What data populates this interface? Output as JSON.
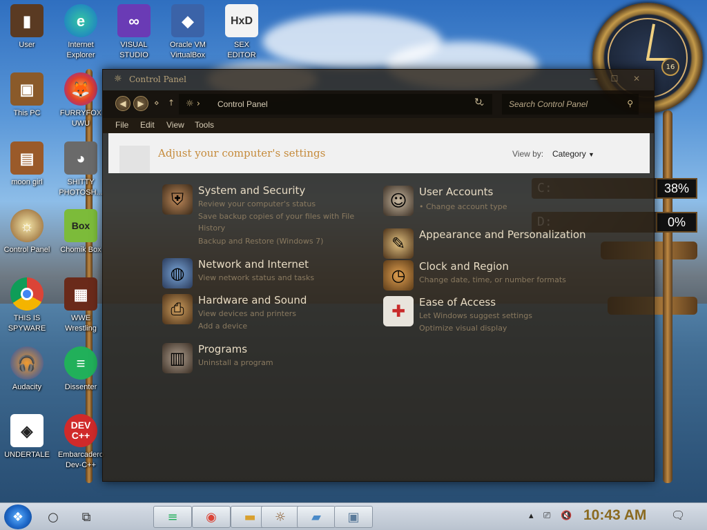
{
  "desktop": {
    "icons": [
      {
        "label": "User",
        "icon": "user-folder-icon"
      },
      {
        "label": "Internet\nExplorer",
        "icon": "edge-icon"
      },
      {
        "label": "VISUAL\nSTUDIO",
        "icon": "visual-studio-icon"
      },
      {
        "label": "Oracle VM\nVirtualBox",
        "icon": "virtualbox-icon"
      },
      {
        "label": "SEX\nEDITOR",
        "icon": "hxd-hex-editor-icon"
      },
      {
        "label": "This PC",
        "icon": "computer-icon"
      },
      {
        "label": "FURRYFOX\nUWU",
        "icon": "firefox-icon"
      },
      {
        "label": "moon girl",
        "icon": "document-icon"
      },
      {
        "label": "SHITTY\nPHOTOSH...",
        "icon": "gimp-icon"
      },
      {
        "label": "Control Panel",
        "icon": "control-panel-icon"
      },
      {
        "label": "Chomik Box",
        "icon": "chomikbox-icon"
      },
      {
        "label": "THIS IS\nSPYWARE",
        "icon": "chrome-icon"
      },
      {
        "label": "WWE\nWrestling",
        "icon": "game-icon"
      },
      {
        "label": "Audacity",
        "icon": "audacity-icon"
      },
      {
        "label": "Dissenter",
        "icon": "dissenter-icon"
      },
      {
        "label": "UNDERTALE",
        "icon": "unity-icon"
      },
      {
        "label": "Embarcadero\nDev-C++",
        "icon": "dev-cpp-icon"
      }
    ],
    "gauges": [
      {
        "label": "C:",
        "percent": "38%"
      },
      {
        "label": "D:",
        "percent": "0%"
      }
    ],
    "clock_dial": "16"
  },
  "window": {
    "title": "Control Panel",
    "address": {
      "breadcrumb": "Control Panel"
    },
    "search": {
      "placeholder": "Search Control Panel"
    },
    "menu": [
      "File",
      "Edit",
      "View",
      "Tools"
    ],
    "heading": "Adjust your computer's settings",
    "view_by_label": "View by:",
    "view_by_value": "Category",
    "categories_left": [
      {
        "title": "System and Security",
        "links": [
          "Review your computer's status",
          "Save backup copies of your files with File",
          "History",
          "Backup and Restore (Windows 7)"
        ],
        "icon": "shield-icon"
      },
      {
        "title": "Network and Internet",
        "links": [
          "View network status and tasks"
        ],
        "icon": "globe-icon"
      },
      {
        "title": "Hardware and Sound",
        "links": [
          "View devices and printers",
          "Add a device"
        ],
        "icon": "printer-icon"
      },
      {
        "title": "Programs",
        "links": [
          "Uninstall a program"
        ],
        "icon": "programs-icon"
      }
    ],
    "categories_right": [
      {
        "title": "User Accounts",
        "links": [
          "Change account type"
        ],
        "icon": "users-icon"
      },
      {
        "title": "Appearance and Personalization",
        "links": [],
        "icon": "paint-icon"
      },
      {
        "title": "Clock and Region",
        "links": [
          "Change date, time, or number formats"
        ],
        "icon": "clock-icon"
      },
      {
        "title": "Ease of Access",
        "links": [
          "Let Windows suggest settings",
          "Optimize visual display"
        ],
        "icon": "first-aid-icon"
      }
    ]
  },
  "taskbar": {
    "time": "10:43 AM"
  },
  "colors": {
    "heading_text": "#c58a3a",
    "window_bg": "#2c2216",
    "clock_text": "#8a6a20"
  }
}
